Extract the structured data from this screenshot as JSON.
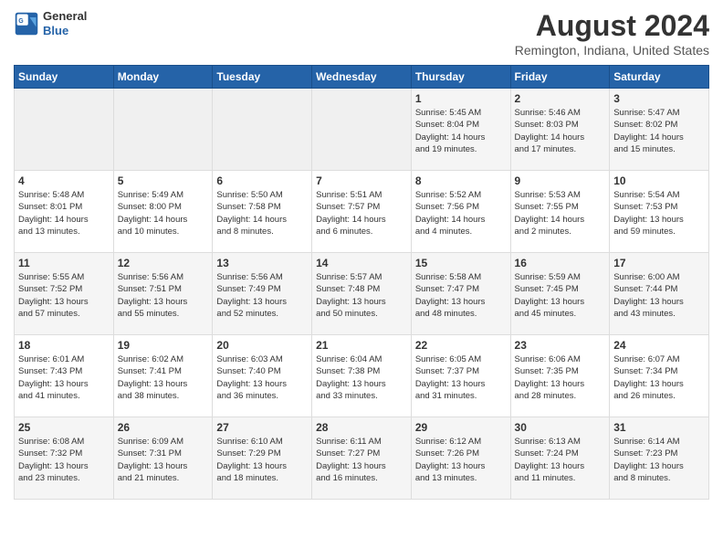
{
  "header": {
    "logo_line1": "General",
    "logo_line2": "Blue",
    "title": "August 2024",
    "subtitle": "Remington, Indiana, United States"
  },
  "days_of_week": [
    "Sunday",
    "Monday",
    "Tuesday",
    "Wednesday",
    "Thursday",
    "Friday",
    "Saturday"
  ],
  "weeks": [
    [
      {
        "day": "",
        "text": ""
      },
      {
        "day": "",
        "text": ""
      },
      {
        "day": "",
        "text": ""
      },
      {
        "day": "",
        "text": ""
      },
      {
        "day": "1",
        "text": "Sunrise: 5:45 AM\nSunset: 8:04 PM\nDaylight: 14 hours\nand 19 minutes."
      },
      {
        "day": "2",
        "text": "Sunrise: 5:46 AM\nSunset: 8:03 PM\nDaylight: 14 hours\nand 17 minutes."
      },
      {
        "day": "3",
        "text": "Sunrise: 5:47 AM\nSunset: 8:02 PM\nDaylight: 14 hours\nand 15 minutes."
      }
    ],
    [
      {
        "day": "4",
        "text": "Sunrise: 5:48 AM\nSunset: 8:01 PM\nDaylight: 14 hours\nand 13 minutes."
      },
      {
        "day": "5",
        "text": "Sunrise: 5:49 AM\nSunset: 8:00 PM\nDaylight: 14 hours\nand 10 minutes."
      },
      {
        "day": "6",
        "text": "Sunrise: 5:50 AM\nSunset: 7:58 PM\nDaylight: 14 hours\nand 8 minutes."
      },
      {
        "day": "7",
        "text": "Sunrise: 5:51 AM\nSunset: 7:57 PM\nDaylight: 14 hours\nand 6 minutes."
      },
      {
        "day": "8",
        "text": "Sunrise: 5:52 AM\nSunset: 7:56 PM\nDaylight: 14 hours\nand 4 minutes."
      },
      {
        "day": "9",
        "text": "Sunrise: 5:53 AM\nSunset: 7:55 PM\nDaylight: 14 hours\nand 2 minutes."
      },
      {
        "day": "10",
        "text": "Sunrise: 5:54 AM\nSunset: 7:53 PM\nDaylight: 13 hours\nand 59 minutes."
      }
    ],
    [
      {
        "day": "11",
        "text": "Sunrise: 5:55 AM\nSunset: 7:52 PM\nDaylight: 13 hours\nand 57 minutes."
      },
      {
        "day": "12",
        "text": "Sunrise: 5:56 AM\nSunset: 7:51 PM\nDaylight: 13 hours\nand 55 minutes."
      },
      {
        "day": "13",
        "text": "Sunrise: 5:56 AM\nSunset: 7:49 PM\nDaylight: 13 hours\nand 52 minutes."
      },
      {
        "day": "14",
        "text": "Sunrise: 5:57 AM\nSunset: 7:48 PM\nDaylight: 13 hours\nand 50 minutes."
      },
      {
        "day": "15",
        "text": "Sunrise: 5:58 AM\nSunset: 7:47 PM\nDaylight: 13 hours\nand 48 minutes."
      },
      {
        "day": "16",
        "text": "Sunrise: 5:59 AM\nSunset: 7:45 PM\nDaylight: 13 hours\nand 45 minutes."
      },
      {
        "day": "17",
        "text": "Sunrise: 6:00 AM\nSunset: 7:44 PM\nDaylight: 13 hours\nand 43 minutes."
      }
    ],
    [
      {
        "day": "18",
        "text": "Sunrise: 6:01 AM\nSunset: 7:43 PM\nDaylight: 13 hours\nand 41 minutes."
      },
      {
        "day": "19",
        "text": "Sunrise: 6:02 AM\nSunset: 7:41 PM\nDaylight: 13 hours\nand 38 minutes."
      },
      {
        "day": "20",
        "text": "Sunrise: 6:03 AM\nSunset: 7:40 PM\nDaylight: 13 hours\nand 36 minutes."
      },
      {
        "day": "21",
        "text": "Sunrise: 6:04 AM\nSunset: 7:38 PM\nDaylight: 13 hours\nand 33 minutes."
      },
      {
        "day": "22",
        "text": "Sunrise: 6:05 AM\nSunset: 7:37 PM\nDaylight: 13 hours\nand 31 minutes."
      },
      {
        "day": "23",
        "text": "Sunrise: 6:06 AM\nSunset: 7:35 PM\nDaylight: 13 hours\nand 28 minutes."
      },
      {
        "day": "24",
        "text": "Sunrise: 6:07 AM\nSunset: 7:34 PM\nDaylight: 13 hours\nand 26 minutes."
      }
    ],
    [
      {
        "day": "25",
        "text": "Sunrise: 6:08 AM\nSunset: 7:32 PM\nDaylight: 13 hours\nand 23 minutes."
      },
      {
        "day": "26",
        "text": "Sunrise: 6:09 AM\nSunset: 7:31 PM\nDaylight: 13 hours\nand 21 minutes."
      },
      {
        "day": "27",
        "text": "Sunrise: 6:10 AM\nSunset: 7:29 PM\nDaylight: 13 hours\nand 18 minutes."
      },
      {
        "day": "28",
        "text": "Sunrise: 6:11 AM\nSunset: 7:27 PM\nDaylight: 13 hours\nand 16 minutes."
      },
      {
        "day": "29",
        "text": "Sunrise: 6:12 AM\nSunset: 7:26 PM\nDaylight: 13 hours\nand 13 minutes."
      },
      {
        "day": "30",
        "text": "Sunrise: 6:13 AM\nSunset: 7:24 PM\nDaylight: 13 hours\nand 11 minutes."
      },
      {
        "day": "31",
        "text": "Sunrise: 6:14 AM\nSunset: 7:23 PM\nDaylight: 13 hours\nand 8 minutes."
      }
    ]
  ]
}
